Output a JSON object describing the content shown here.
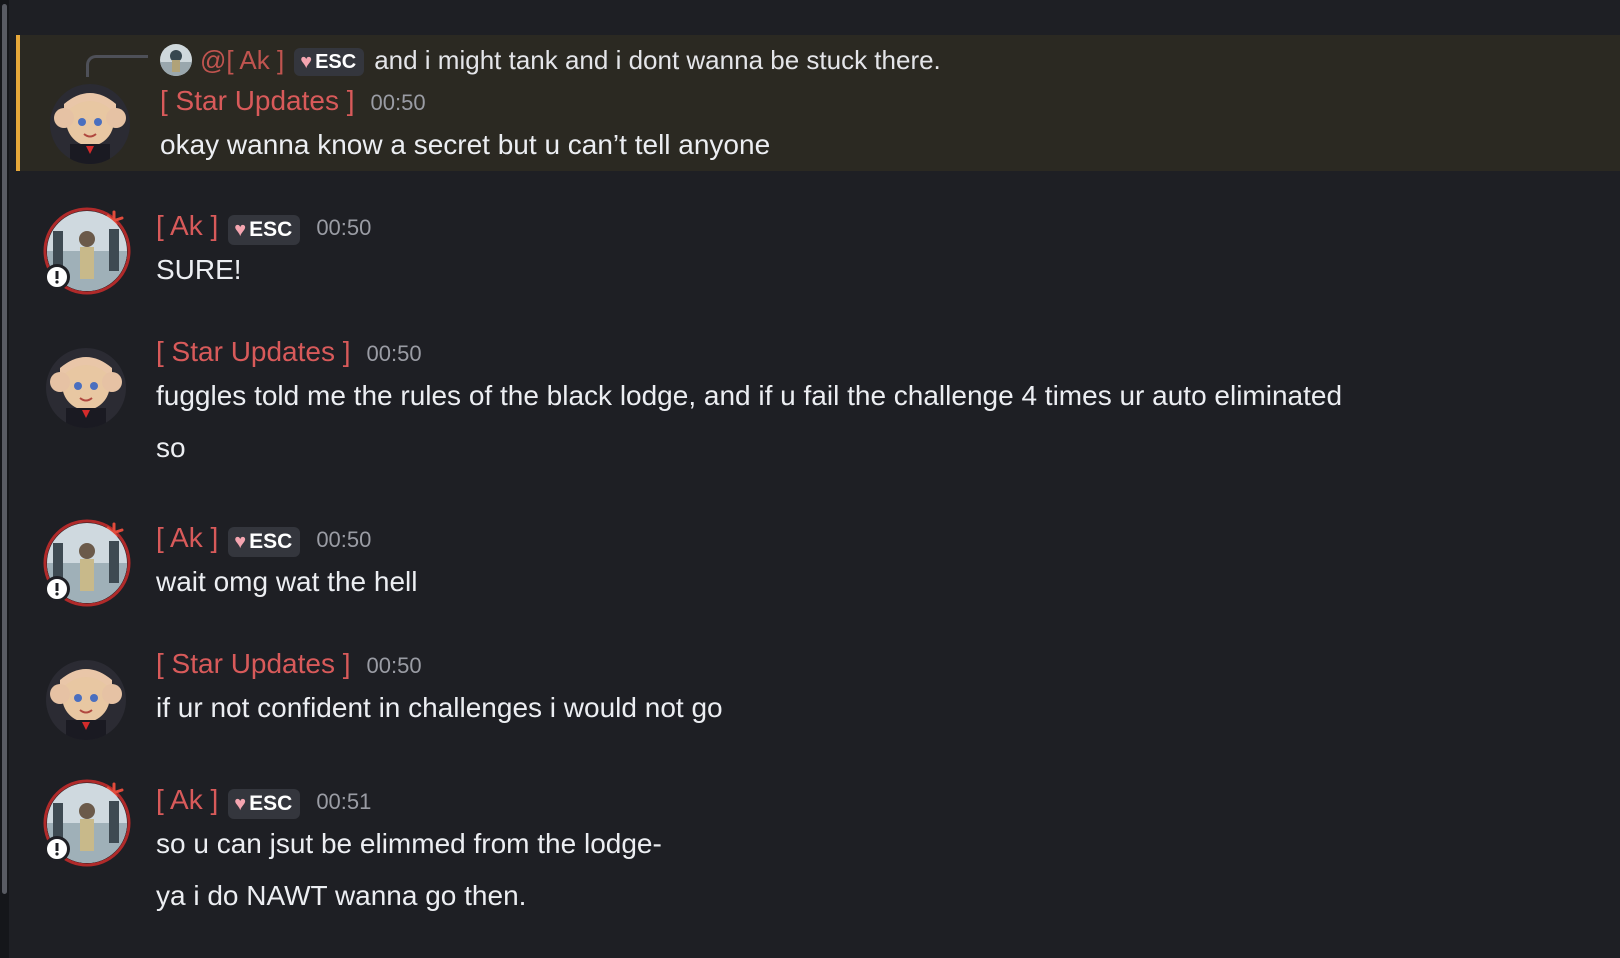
{
  "reply_preview": {
    "author": "@[ Ak ]",
    "tag": "ESC",
    "text": "and i might tank and i dont wanna be stuck there."
  },
  "messages": [
    {
      "author": "[ Star Updates ]",
      "time": "00:50",
      "tag": "",
      "avatar": "girl-pigtails-avatar",
      "lines": [
        "okay wanna know a secret but u can’t tell anyone"
      ],
      "highlighted": true
    },
    {
      "author": "[ Ak ]",
      "time": "00:50",
      "tag": "ESC",
      "avatar": "photo-avatar",
      "lines": [
        "SURE!"
      ]
    },
    {
      "author": "[ Star Updates ]",
      "time": "00:50",
      "tag": "",
      "avatar": "girl-pigtails-avatar",
      "lines": [
        "fuggles told me the rules of the black lodge, and if u fail the challenge 4 times ur auto eliminated",
        "so"
      ]
    },
    {
      "author": "[ Ak ]",
      "time": "00:50",
      "tag": "ESC",
      "avatar": "photo-avatar",
      "lines": [
        "wait omg wat the hell"
      ]
    },
    {
      "author": "[ Star Updates ]",
      "time": "00:50",
      "tag": "",
      "avatar": "girl-pigtails-avatar",
      "lines": [
        "if ur not confident in challenges i would not go"
      ]
    },
    {
      "author": "[ Ak ]",
      "time": "00:51",
      "tag": "ESC",
      "avatar": "photo-avatar",
      "lines": [
        "so u can jsut be elimmed from the lodge-",
        "ya i do NAWT wanna go then."
      ]
    }
  ],
  "colors": {
    "background": "#1e1f24",
    "highlight_bg": "#2b2922",
    "highlight_border": "#e6a73a",
    "username": "#d85a5a",
    "timestamp": "#9a9ca4"
  }
}
